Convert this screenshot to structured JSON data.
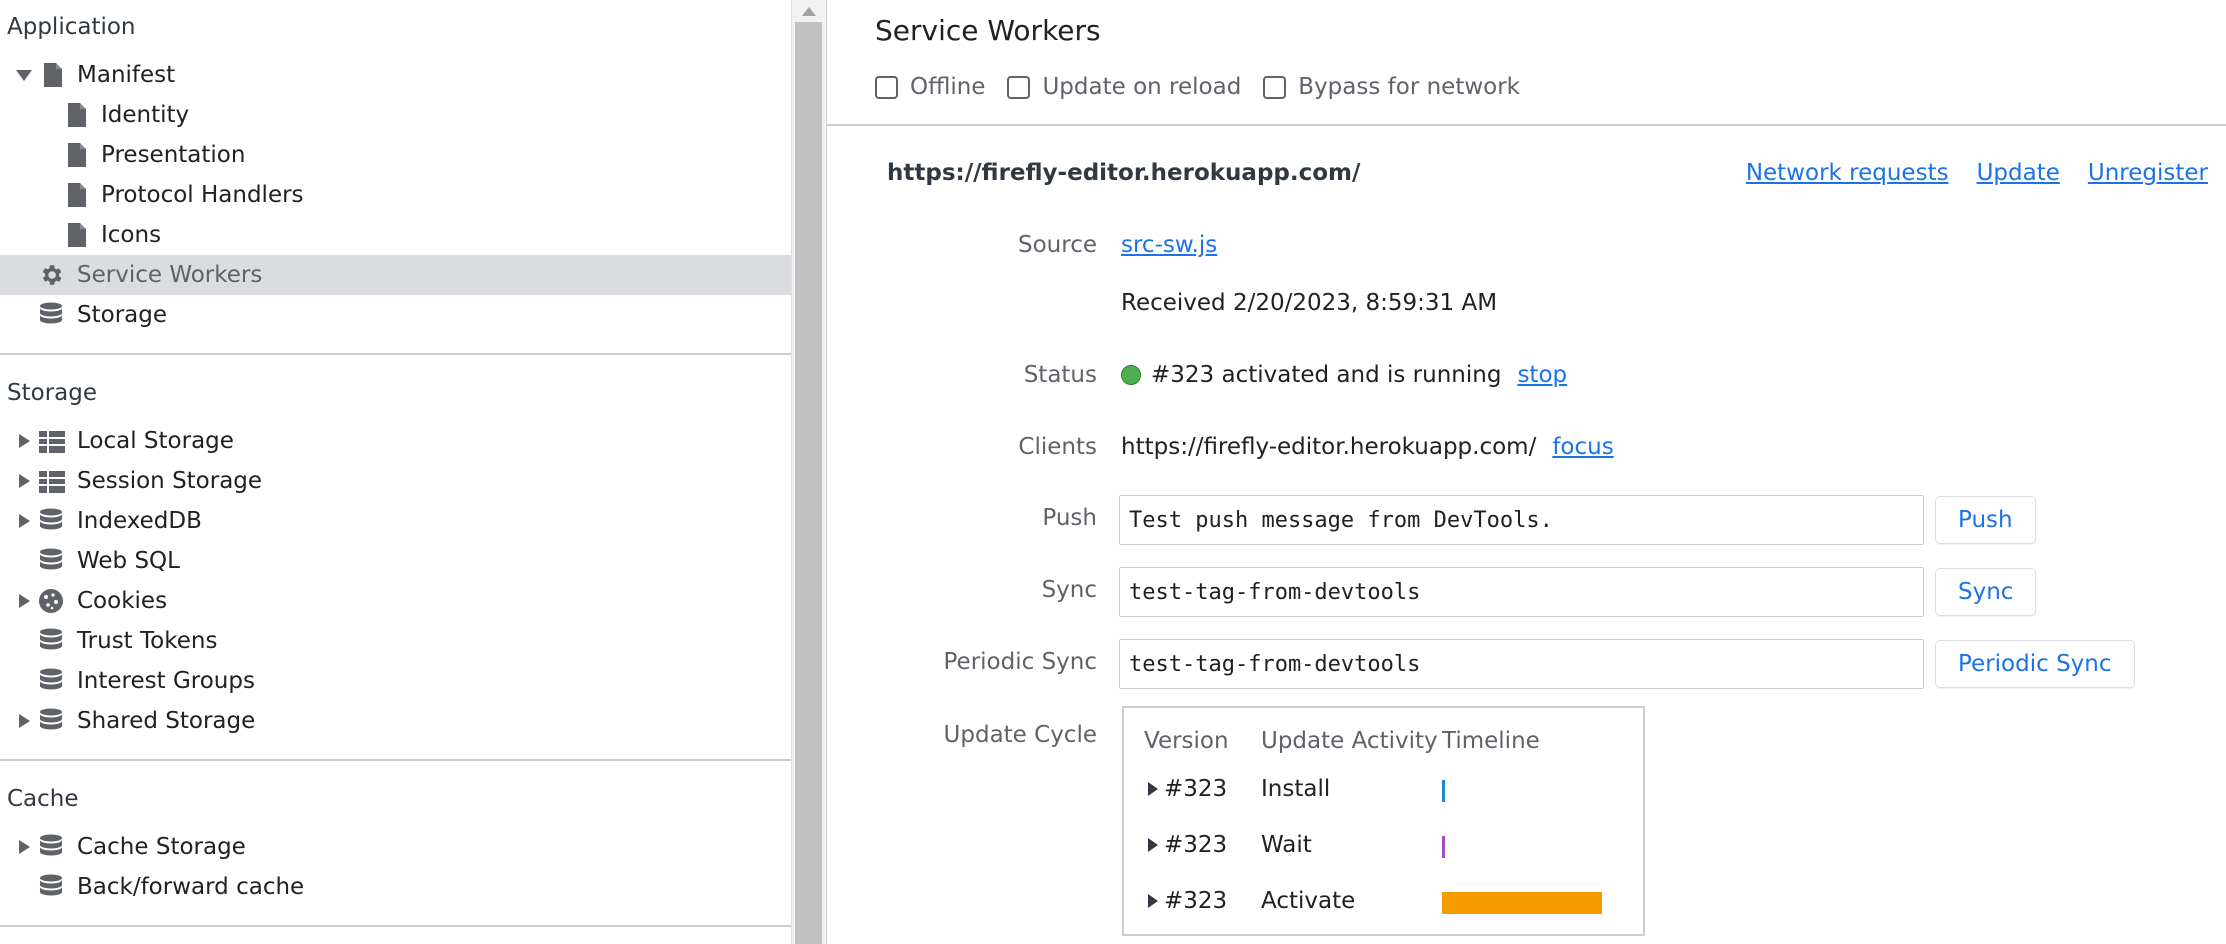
{
  "sidebar": {
    "application_header": "Application",
    "application_items": [
      {
        "label": "Manifest",
        "icon": "file-icon",
        "expanded": true
      },
      {
        "label": "Identity",
        "icon": "file-icon"
      },
      {
        "label": "Presentation",
        "icon": "file-icon"
      },
      {
        "label": "Protocol Handlers",
        "icon": "file-icon"
      },
      {
        "label": "Icons",
        "icon": "file-icon"
      },
      {
        "label": "Service Workers",
        "icon": "gear-icon",
        "selected": true
      },
      {
        "label": "Storage",
        "icon": "database-icon"
      }
    ],
    "storage_header": "Storage",
    "storage_items": [
      {
        "label": "Local Storage",
        "icon": "grid-icon",
        "expandable": true
      },
      {
        "label": "Session Storage",
        "icon": "grid-icon",
        "expandable": true
      },
      {
        "label": "IndexedDB",
        "icon": "database-icon",
        "expandable": true
      },
      {
        "label": "Web SQL",
        "icon": "database-icon"
      },
      {
        "label": "Cookies",
        "icon": "cookie-icon",
        "expandable": true
      },
      {
        "label": "Trust Tokens",
        "icon": "database-icon"
      },
      {
        "label": "Interest Groups",
        "icon": "database-icon"
      },
      {
        "label": "Shared Storage",
        "icon": "database-icon",
        "expandable": true
      }
    ],
    "cache_header": "Cache",
    "cache_items": [
      {
        "label": "Cache Storage",
        "icon": "database-icon",
        "expandable": true
      },
      {
        "label": "Back/forward cache",
        "icon": "database-icon"
      }
    ]
  },
  "main": {
    "title": "Service Workers",
    "toolbar": {
      "offline": "Offline",
      "update_on_reload": "Update on reload",
      "bypass_for_network": "Bypass for network"
    },
    "origin": "https://firefly-editor.herokuapp.com/",
    "actions": {
      "network_requests": "Network requests",
      "update": "Update",
      "unregister": "Unregister"
    },
    "source": {
      "label": "Source",
      "file": "src-sw.js",
      "received": "Received 2/20/2023, 8:59:31 AM"
    },
    "status": {
      "label": "Status",
      "text": "#323 activated and is running",
      "stop": "stop",
      "dot_color": "#4caf50"
    },
    "clients": {
      "label": "Clients",
      "url": "https://firefly-editor.herokuapp.com/",
      "focus": "focus"
    },
    "push": {
      "label": "Push",
      "value": "Test push message from DevTools.",
      "button": "Push"
    },
    "sync": {
      "label": "Sync",
      "value": "test-tag-from-devtools",
      "button": "Sync"
    },
    "periodic_sync": {
      "label": "Periodic Sync",
      "value": "test-tag-from-devtools",
      "button": "Periodic Sync"
    },
    "update_cycle": {
      "label": "Update Cycle",
      "headers": [
        "Version",
        "Update Activity",
        "Timeline"
      ],
      "rows": [
        {
          "version": "#323",
          "activity": "Install",
          "color": "#1e88c8"
        },
        {
          "version": "#323",
          "activity": "Wait",
          "color": "#a14cc9"
        },
        {
          "version": "#323",
          "activity": "Activate",
          "color": "#f59b00"
        }
      ]
    }
  }
}
